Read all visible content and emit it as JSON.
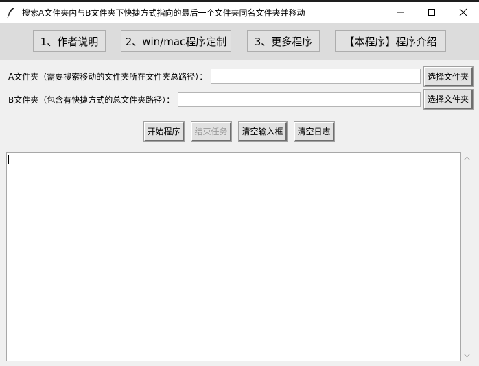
{
  "window": {
    "title": "搜索A文件夹内与B文件夹下快捷方式指向的最后一个文件夹同名文件夹并移动",
    "minimize_glyph": "—",
    "maximize_glyph": "☐",
    "close_glyph": "✕",
    "app_icon": "feather-icon"
  },
  "toolbar": {
    "buttons": [
      {
        "label": "1、作者说明"
      },
      {
        "label": "2、win/mac程序定制"
      },
      {
        "label": "3、更多程序"
      },
      {
        "label": "【本程序】程序介绍"
      }
    ]
  },
  "form": {
    "a_label": "A文件夹（需要搜索移动的文件夹所在文件夹总路径）：",
    "a_value": "",
    "a_browse": "选择文件夹",
    "b_label": "B文件夹（包含有快捷方式的总文件夹路径）：",
    "b_value": "",
    "b_browse": "选择文件夹"
  },
  "actions": {
    "start": "开始程序",
    "stop": "结束任务",
    "clear_inputs": "清空输入框",
    "clear_log": "清空日志"
  },
  "log": {
    "content": ""
  },
  "colors": {
    "toolbar_bg": "#dcdcdc",
    "window_bg": "#f0f0f0",
    "disabled_text": "#9a9a9a"
  }
}
